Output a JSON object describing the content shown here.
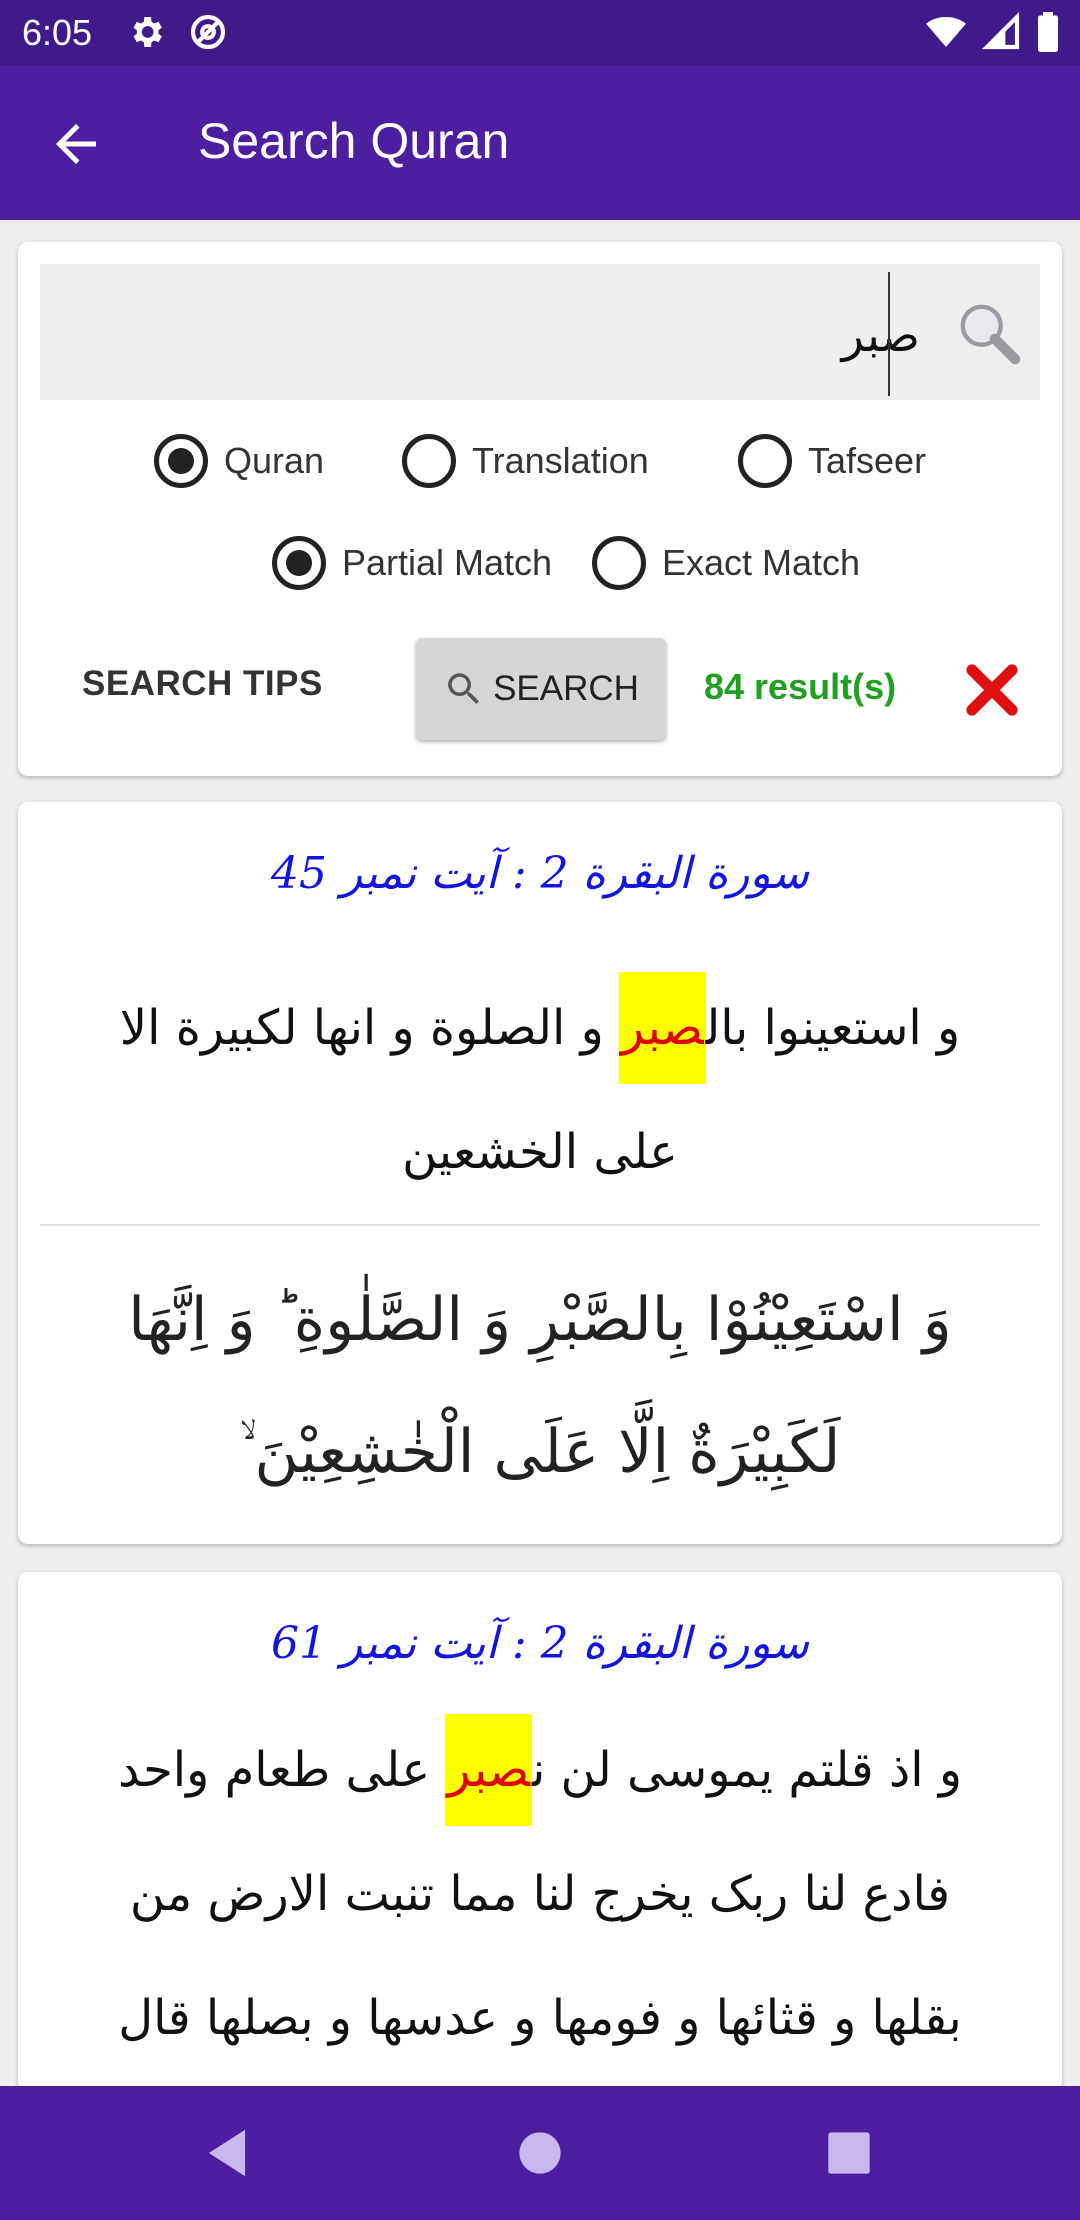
{
  "status_bar": {
    "time": "6:05",
    "icons": [
      "gear-icon",
      "at-sign-icon",
      "wifi-icon",
      "signal-icon",
      "battery-icon"
    ]
  },
  "app_bar": {
    "title": "Search Quran"
  },
  "search": {
    "query": "صبر",
    "scope_options": [
      {
        "label": "Quran",
        "checked": true
      },
      {
        "label": "Translation",
        "checked": false
      },
      {
        "label": "Tafseer",
        "checked": false
      }
    ],
    "match_options": [
      {
        "label": "Partial Match",
        "checked": true
      },
      {
        "label": "Exact Match",
        "checked": false
      }
    ],
    "tips_label": "SEARCH TIPS",
    "search_label": "SEARCH",
    "result_count": "84 result(s)"
  },
  "results": [
    {
      "ref": "سورة البقرة 2 : آیت نمبر 45",
      "urdu_before": "و استعینوا بال",
      "urdu_highlight": "صبر",
      "urdu_after": " و الصلوة و انها لکبیرة الا علی الخشعین",
      "arabic": "وَ اسْتَعِيْنُوْا بِالصَّبْرِ وَ الصَّلٰوةِ ؕ وَ اِنَّهَا لَكَبِيْرَةٌ اِلَّا عَلَى الْخٰشِعِيْنَ ۙ"
    },
    {
      "ref": "سورة البقرة 2 : آیت نمبر 61",
      "urdu_before": "و اذ قلتم یموسی لن ن",
      "urdu_highlight": "صبر",
      "urdu_after": " علی طعام واحد فادع لنا ربک یخرج لنا مما تنبت الارض من بقلها و قثائها و فومها و عدسها و بصلها قال اتستبدلون الذي هو"
    }
  ],
  "colors": {
    "status_bar": "#3f1a8a",
    "app_bar": "#4c1fa1",
    "ref_blue": "#1414e0",
    "highlight_bg": "#ffff00",
    "highlight_text": "#e00000",
    "result_green": "#20a020",
    "clear_red": "#e01010"
  }
}
